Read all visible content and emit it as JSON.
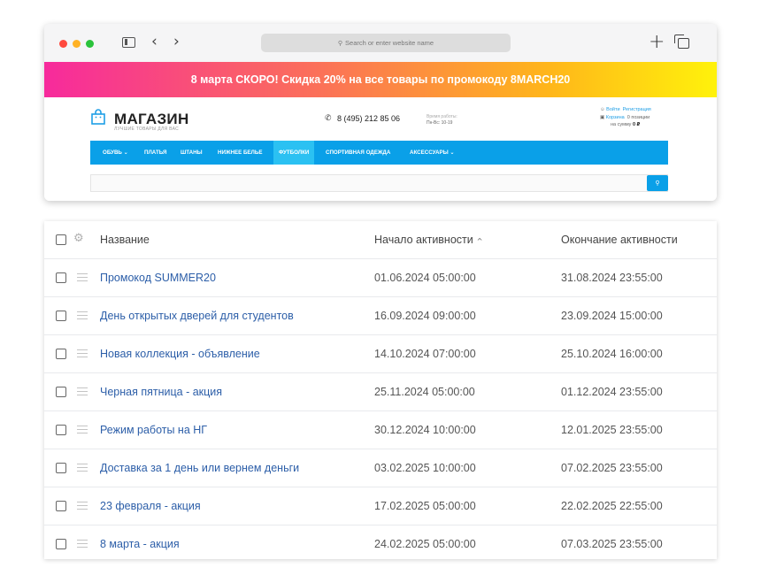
{
  "browser": {
    "address_placeholder": "Search or enter website name",
    "back_glyph": "‹",
    "forward_glyph": "›",
    "icons": [
      "sidebar-icon",
      "back-icon",
      "forward-icon",
      "search-icon",
      "plus-icon",
      "tabs-icon"
    ]
  },
  "site": {
    "promo_text": "8 марта СКОРО! Скидка 20% на все товары по промокоду 8MARCH20",
    "logo": "МАГАЗИН",
    "tagline": "ЛУЧШИЕ ТОВАРЫ ДЛЯ ВАС",
    "phone": "8 (495) 212 85 06",
    "hours_label": "Время работы:",
    "hours_value": "Пн-Вс: 10-19",
    "login": "Войти",
    "register": "Регистрация",
    "cart_label": "Корзина",
    "cart_count": "0 позиции",
    "cart_sum_label": "на сумму",
    "cart_sum_value": "0 ₽",
    "menu": [
      {
        "label": "ОБУВЬ ⌄"
      },
      {
        "label": "ПЛАТЬЯ"
      },
      {
        "label": "ШТАНЫ"
      },
      {
        "label": "НИЖНЕЕ БЕЛЬЕ"
      },
      {
        "label": "ФУТБОЛКИ"
      },
      {
        "label": "СПОРТИВНАЯ ОДЕЖДА"
      },
      {
        "label": "АКСЕССУАРЫ ⌄"
      }
    ],
    "colors": {
      "menu": "#0aa0e8",
      "menu_active": "#2bc1f2",
      "link": "#2c5ea8"
    }
  },
  "table": {
    "headers": {
      "name": "Название",
      "start": "Начало активности",
      "end": "Окончание активности"
    },
    "sort_indicator": "^",
    "rows": [
      {
        "name": "Промокод SUMMER20",
        "start": "01.06.2024 05:00:00",
        "end": "31.08.2024 23:55:00"
      },
      {
        "name": "День открытых дверей для студентов",
        "start": "16.09.2024 09:00:00",
        "end": "23.09.2024 15:00:00"
      },
      {
        "name": "Новая коллекция - объявление",
        "start": "14.10.2024 07:00:00",
        "end": "25.10.2024 16:00:00"
      },
      {
        "name": "Черная пятница - акция",
        "start": "25.11.2024 05:00:00",
        "end": "01.12.2024 23:55:00"
      },
      {
        "name": "Режим работы на НГ",
        "start": "30.12.2024 10:00:00",
        "end": "12.01.2025 23:55:00"
      },
      {
        "name": "Доставка за 1 день или вернем деньги",
        "start": "03.02.2025 10:00:00",
        "end": "07.02.2025 23:55:00"
      },
      {
        "name": "23 февраля - акция",
        "start": "17.02.2025 05:00:00",
        "end": "22.02.2025 22:55:00"
      },
      {
        "name": "8 марта - акция",
        "start": "24.02.2025 05:00:00",
        "end": "07.03.2025 23:55:00"
      }
    ]
  }
}
